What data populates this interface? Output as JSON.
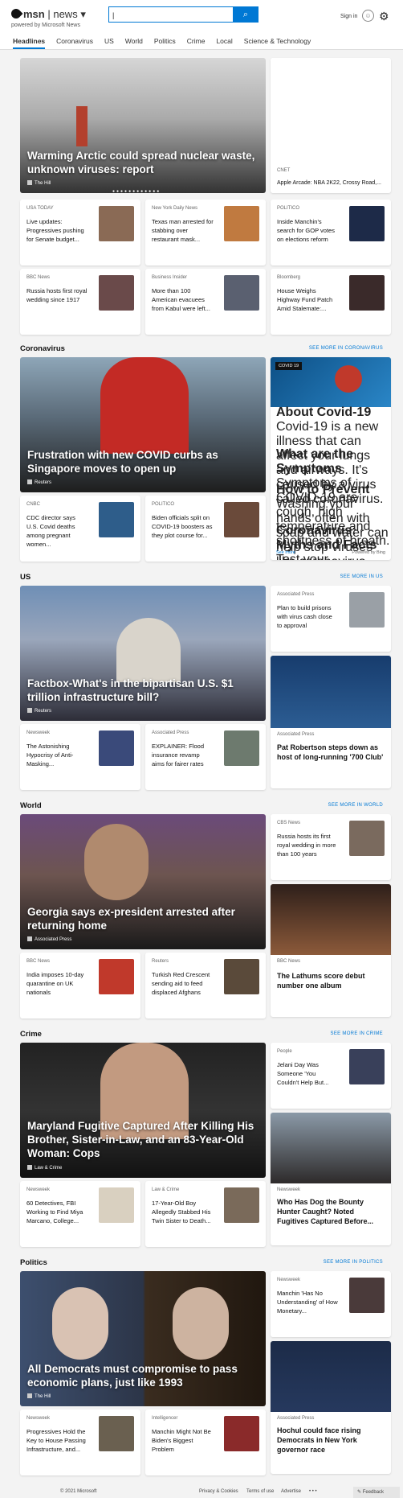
{
  "header": {
    "brand": "msn",
    "section": "news",
    "subtitle": "powered by Microsoft News",
    "search_value": "|",
    "signin": "Sign in"
  },
  "nav": [
    "Headlines",
    "Coronavirus",
    "US",
    "World",
    "Politics",
    "Crime",
    "Local",
    "Science & Technology"
  ],
  "top": {
    "hero_title": "Warming Arctic could spread nuclear waste, unknown viruses: report",
    "hero_src": "The Hill",
    "side_src": "CNET",
    "side_title": "Apple Arcade: NBA 2K22, Crossy Road,...",
    "cards": [
      {
        "src": "USA TODAY",
        "title": "Live updates: Progressives pushing for Senate budget..."
      },
      {
        "src": "New York Daily News",
        "title": "Texas man arrested for stabbing over restaurant mask..."
      },
      {
        "src": "POLITICO",
        "title": "Inside Manchin's search for GOP votes on elections reform"
      },
      {
        "src": "BBC News",
        "title": "Russia hosts first royal wedding since 1917"
      },
      {
        "src": "Business Insider",
        "title": "More than 100 American evacuees from Kabul were left..."
      },
      {
        "src": "Bloomberg",
        "title": "House Weighs Highway Fund Patch Amid Stalemate:..."
      }
    ]
  },
  "corona": {
    "section": "Coronavirus",
    "seemore": "SEE MORE IN CORONAVIRUS",
    "hero_title": "Frustration with new COVID curbs as Singapore moves to open up",
    "hero_src": "Reuters",
    "badge": "COVID 19",
    "info": [
      {
        "h": "About Covid-19",
        "p": "Covid-19 is a new illness that can affect your lungs and airways. It's caused by a virus called coronavirus."
      },
      {
        "h": "What are the Symptoms",
        "p": "Symptoms of COVID-19 are cough, high temperature and shortness of breath."
      },
      {
        "h": "How to Prevent",
        "p": "Washing your hands often with soap and water can help stop viruses like coronavirus (COVID-19) spreading."
      },
      {
        "h": "Coronavirus: Myths and Facts",
        "p": "Test your awareness about COVID-19."
      }
    ],
    "info_more": "See more",
    "info_by": "Powered by Bing",
    "cards": [
      {
        "src": "CNBC",
        "title": "CDC director says U.S. Covid deaths among pregnant women..."
      },
      {
        "src": "POLITICO",
        "title": "Biden officials split on COVID-19 boosters as they plot course for..."
      }
    ]
  },
  "us": {
    "section": "US",
    "seemore": "SEE MORE IN US",
    "hero_title": "Factbox-What's in the bipartisan U.S. $1 trillion infrastructure bill?",
    "hero_src": "Reuters",
    "side": {
      "src": "Associated Press",
      "title": "Plan to build prisons with virus cash close to approval"
    },
    "side2": {
      "src": "Associated Press",
      "title": "Pat Robertson steps down as host of long-running '700 Club'"
    },
    "cards": [
      {
        "src": "Newsweek",
        "title": "The Astonishing Hypocrisy of Anti-Masking..."
      },
      {
        "src": "Associated Press",
        "title": "EXPLAINER: Flood insurance revamp aims for fairer rates"
      }
    ]
  },
  "world": {
    "section": "World",
    "seemore": "SEE MORE IN WORLD",
    "hero_title": "Georgia says ex-president arrested after returning home",
    "hero_src": "Associated Press",
    "side": {
      "src": "CBS News",
      "title": "Russia hosts its first royal wedding in more than 100 years"
    },
    "side2": {
      "src": "BBC News",
      "title": "The Lathums score debut number one album"
    },
    "cards": [
      {
        "src": "BBC News",
        "title": "India imposes 10-day quarantine on UK nationals"
      },
      {
        "src": "Reuters",
        "title": "Turkish Red Crescent sending aid to feed displaced Afghans"
      }
    ]
  },
  "crime": {
    "section": "Crime",
    "seemore": "SEE MORE IN CRIME",
    "hero_title": "Maryland Fugitive Captured After Killing His Brother, Sister-in-Law, and an 83-Year-Old Woman: Cops",
    "hero_src": "Law & Crime",
    "side": {
      "src": "People",
      "title": "Jelani Day Was Someone 'You Couldn't Help But..."
    },
    "side2": {
      "src": "Newsweek",
      "title": "Who Has Dog the Bounty Hunter Caught? Noted Fugitives Captured Before..."
    },
    "cards": [
      {
        "src": "Newsweek",
        "title": "60 Detectives, FBI Working to Find Miya Marcano, College..."
      },
      {
        "src": "Law & Crime",
        "title": "17-Year-Old Boy Allegedly Stabbed His Twin Sister to Death..."
      }
    ]
  },
  "politics": {
    "section": "Politics",
    "seemore": "SEE MORE IN POLITICS",
    "hero_title": "All Democrats must compromise to pass economic plans, just like 1993",
    "hero_src": "The Hill",
    "side": {
      "src": "Newsweek",
      "title": "Manchin 'Has No Understanding' of How Monetary..."
    },
    "side2": {
      "src": "Associated Press",
      "title": "Hochul could face rising Democrats in New York governor race"
    },
    "cards": [
      {
        "src": "Newsweek",
        "title": "Progressives Hold the Key to House Passing Infrastructure, and..."
      },
      {
        "src": "Intelligencer",
        "title": "Manchin Might Not Be Biden's Biggest Problem"
      }
    ]
  },
  "footer": {
    "copy": "© 2021 Microsoft",
    "privacy": "Privacy & Cookies",
    "terms": "Terms of use",
    "ad": "Advertise",
    "more": "• • •",
    "feedback": "Feedback"
  }
}
